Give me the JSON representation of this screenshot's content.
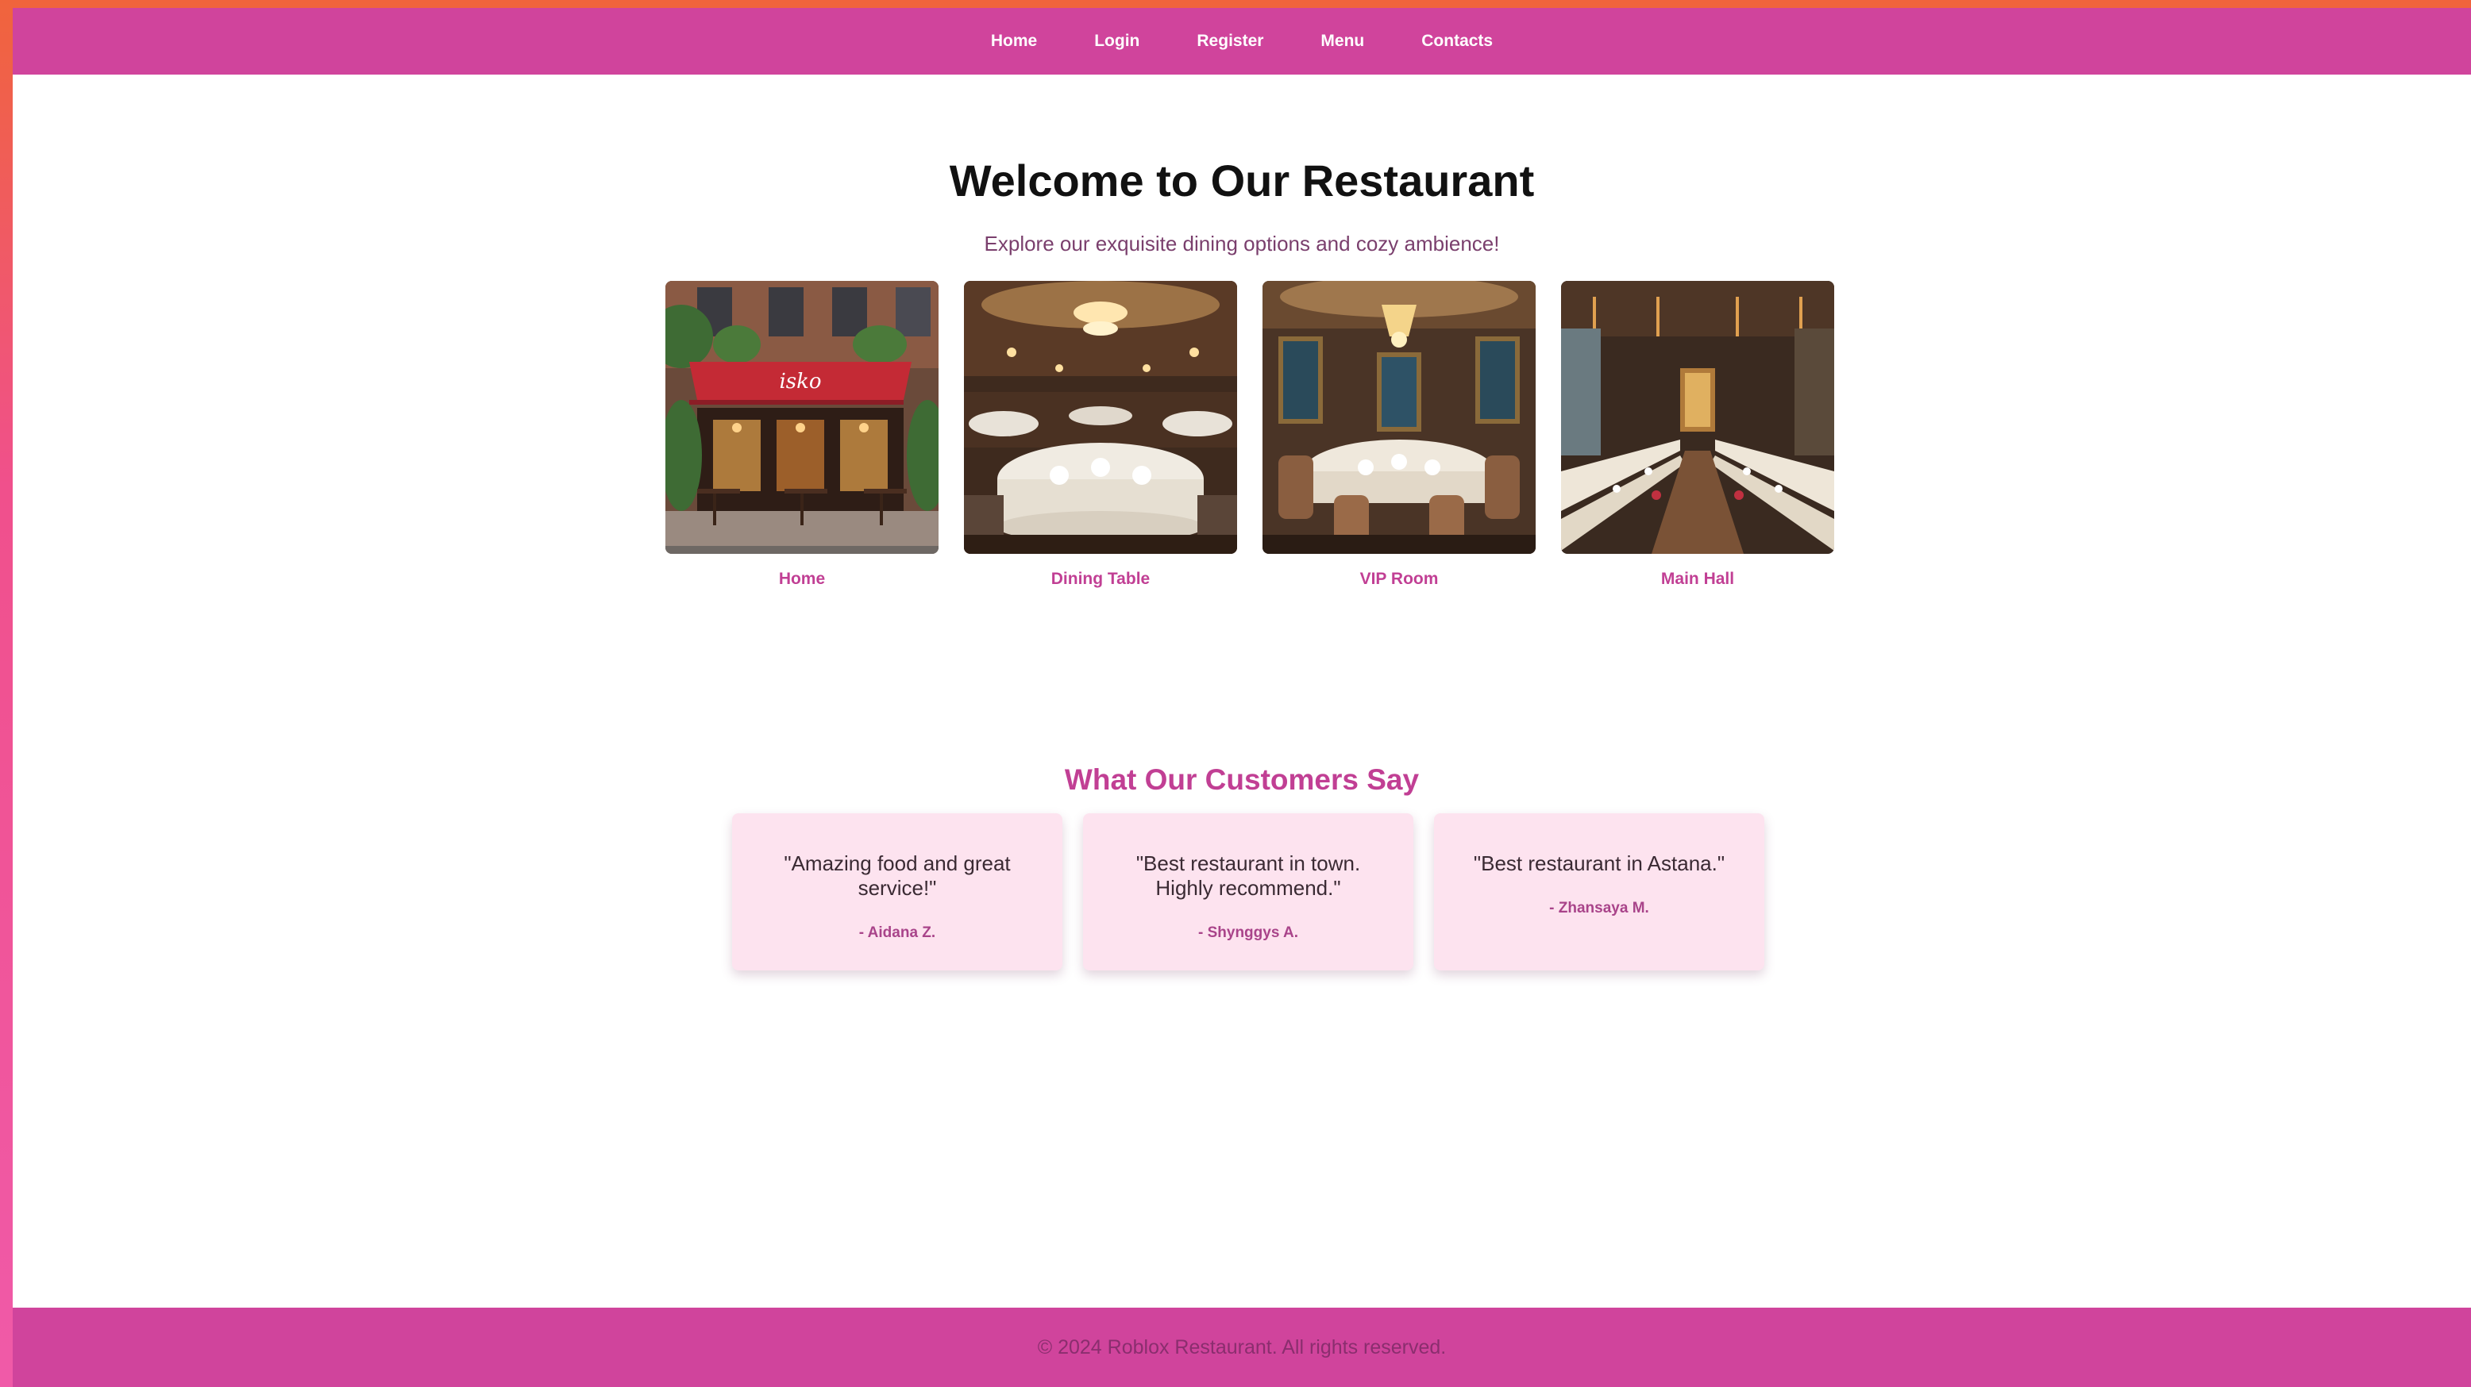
{
  "nav": {
    "items": [
      {
        "label": "Home"
      },
      {
        "label": "Login"
      },
      {
        "label": "Register"
      },
      {
        "label": "Menu"
      },
      {
        "label": "Contacts"
      }
    ]
  },
  "hero": {
    "title": "Welcome to Our Restaurant",
    "subtitle": "Explore our exquisite dining options and cozy ambience!"
  },
  "gallery": {
    "items": [
      {
        "caption": "Home",
        "image": "restaurant-storefront-photo",
        "sign_text": "isko"
      },
      {
        "caption": "Dining Table",
        "image": "dining-table-photo"
      },
      {
        "caption": "VIP Room",
        "image": "vip-room-photo"
      },
      {
        "caption": "Main Hall",
        "image": "main-hall-photo"
      }
    ]
  },
  "testimonials": {
    "title": "What Our Customers Say",
    "items": [
      {
        "quote": "\"Amazing food and great service!\"",
        "author": "- Aidana Z."
      },
      {
        "quote": "\"Best restaurant in town. Highly recommend.\"",
        "author": "- Shynggys A."
      },
      {
        "quote": "\"Best restaurant in Astana.\"",
        "author": "- Zhansaya M."
      }
    ]
  },
  "footer": {
    "text": "© 2024 Roblox Restaurant. All rights reserved."
  },
  "colors": {
    "brand": "#d0449c",
    "accent_text": "#c13f94",
    "card_bg": "#fde3ef"
  }
}
